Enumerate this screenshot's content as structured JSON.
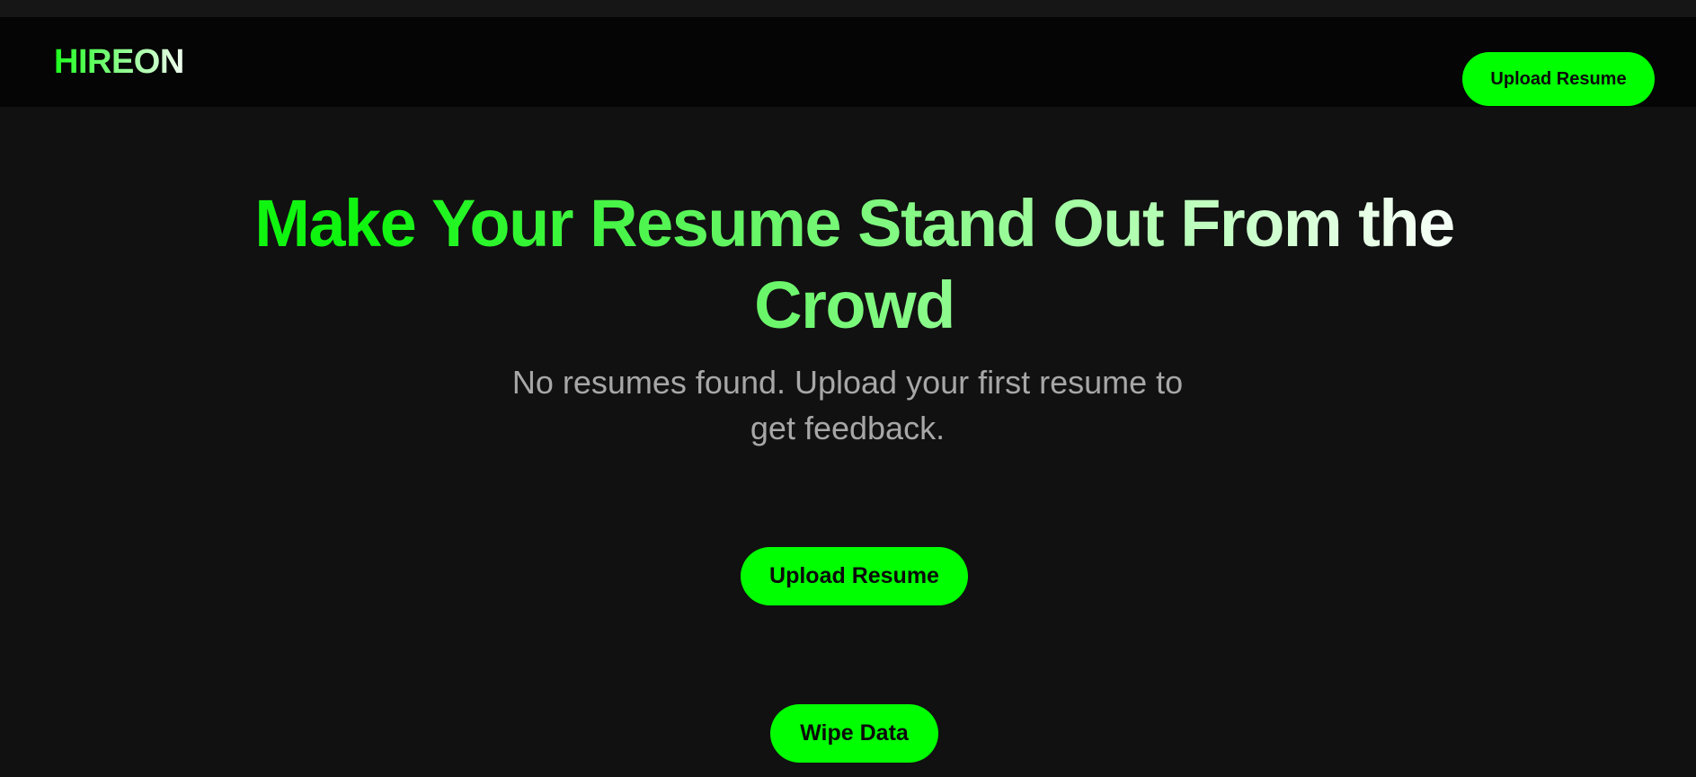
{
  "colors": {
    "background": "#111111",
    "navbar_background": "#050505",
    "accent": "#00ff00",
    "subtitle_text": "#a7a7a7",
    "button_text": "#0a0a0a"
  },
  "header": {
    "brand": "HIREON",
    "upload_button_label": "Upload Resume"
  },
  "hero": {
    "title": "Make Your Resume Stand Out From the Crowd",
    "subtitle": "No resumes found. Upload your first resume to get feedback."
  },
  "actions": {
    "upload_button_label": "Upload Resume",
    "wipe_button_label": "Wipe Data"
  }
}
